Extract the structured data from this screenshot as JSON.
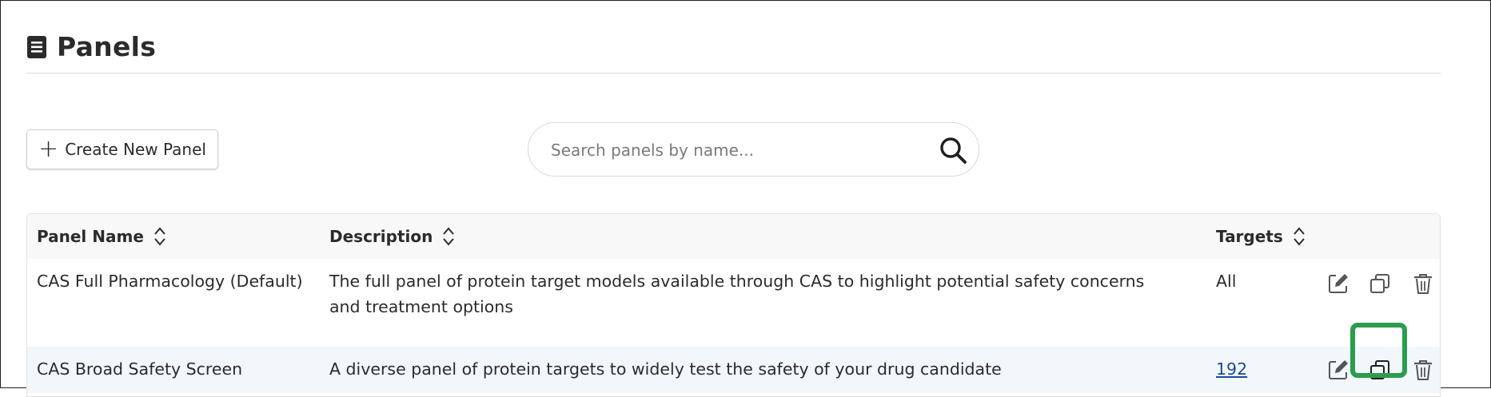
{
  "page": {
    "title": "Panels",
    "icon": "document-icon"
  },
  "toolbar": {
    "create_label": "Create New Panel",
    "create_icon": "plus-icon"
  },
  "search": {
    "placeholder": "Search panels by name...",
    "value": "",
    "icon": "search-icon"
  },
  "table": {
    "columns": [
      {
        "label": "Panel Name",
        "sortable": true
      },
      {
        "label": "Description",
        "sortable": true
      },
      {
        "label": "Targets",
        "sortable": true
      }
    ],
    "rows": [
      {
        "name": "CAS Full Pharmacology (Default)",
        "description": "The full panel of protein target models available through CAS to highlight potential safety concerns and treatment options",
        "targets": "All",
        "targets_is_link": false
      },
      {
        "name": "CAS Broad Safety Screen",
        "description": "A diverse panel of protein targets to widely test the safety of your drug candidate",
        "targets": "192",
        "targets_is_link": true
      }
    ],
    "row_actions": [
      "edit-icon",
      "copy-icon",
      "trash-icon"
    ]
  },
  "colors": {
    "highlight": "#2a9d4f",
    "link": "#1a4a9c",
    "selected_row": "#f2f7fb",
    "header_bg": "#f8f8f8"
  }
}
